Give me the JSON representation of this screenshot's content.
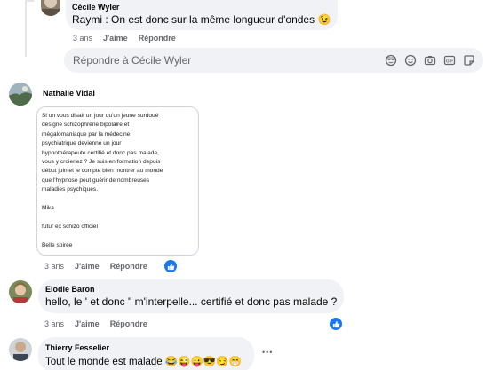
{
  "comments": [
    {
      "author": "Cécile Wyler",
      "mention": "Raymi",
      "text": " : On est donc sur la même longueur d'ondes 😉",
      "time": "3 ans",
      "like_label": "J'aime",
      "reply_label": "Répondre"
    },
    {
      "author": "Nathalie Vidal",
      "card_lines": [
        "Si on vous disait un jour qu'un jeune surdoué",
        "désigné schizophrène bipolaire et",
        "mégalomaniaque par la médecine",
        "psychiatrique devienne un jour",
        "hypnothérapeute certifié et donc pas malade,",
        "vous y croieriez ? Je suis en formation depuis",
        "début juin et je compte bien montrer au monde",
        "que l'hypnose peut guérir de nombreuses",
        "maladies psychiques.",
        "",
        "Mika",
        "",
        "futur ex schizo officiel",
        "",
        "Belle soirée"
      ],
      "time": "3 ans",
      "like_label": "J'aime",
      "reply_label": "Répondre"
    },
    {
      "author": "Elodie Baron",
      "text": "hello, le ' et donc \" m'interpelle... certifié et donc pas malade ?",
      "time": "3 ans",
      "like_label": "J'aime",
      "reply_label": "Répondre"
    },
    {
      "author": "Thierry Fesselier",
      "text": "Tout le monde est malade 😂😜😛😎😏😁",
      "more": "•••"
    }
  ],
  "reply_box": {
    "placeholder": "Répondre à Cécile Wyler",
    "icons": [
      "sticker-icon",
      "emoji-icon",
      "camera-icon",
      "gif-icon",
      "stickers-icon"
    ]
  },
  "colors": {
    "bubble": "#f0f2f5",
    "like_blue": "#1877f2",
    "muted_text": "#65676b"
  }
}
